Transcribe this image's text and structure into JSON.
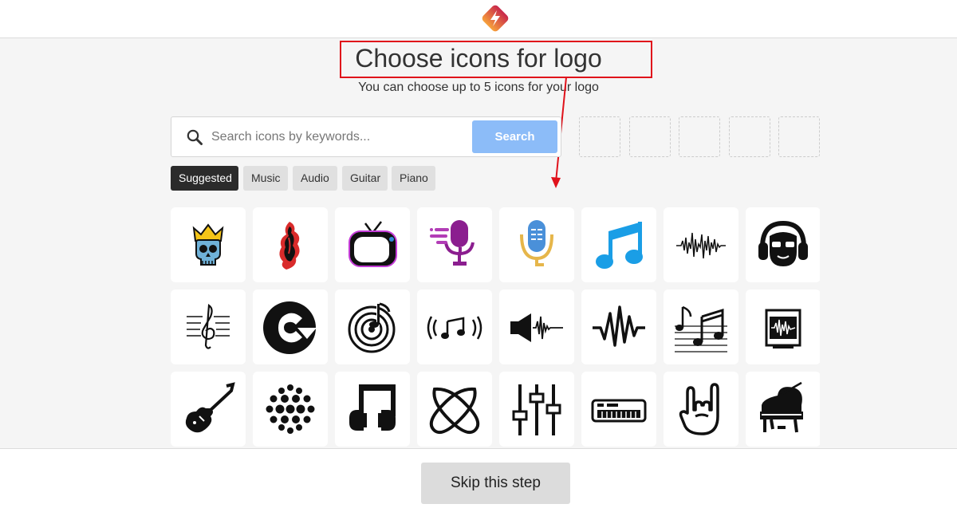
{
  "header": {
    "logo_icon": "brand-logo-icon",
    "colors": {
      "top": "#c8264b",
      "bottom": "#f7a23b",
      "white": "#ffffff"
    }
  },
  "page": {
    "title": "Choose icons for logo",
    "subtitle": "You can choose up to 5 icons for your logo"
  },
  "annotation": {
    "color": "#e0121b"
  },
  "search": {
    "placeholder": "Search icons by keywords...",
    "value": "",
    "button_label": "Search",
    "button_color": "#8cbcf8",
    "selected_slots": 5
  },
  "tags": [
    {
      "label": "Suggested",
      "active": true
    },
    {
      "label": "Music",
      "active": false
    },
    {
      "label": "Audio",
      "active": false
    },
    {
      "label": "Guitar",
      "active": false
    },
    {
      "label": "Piano",
      "active": false
    }
  ],
  "icons": [
    {
      "name": "skull-crown-icon",
      "colors": [
        "#f5c518",
        "#6fb1d8",
        "#111111"
      ]
    },
    {
      "name": "fire-mermaid-icon",
      "colors": [
        "#d92b2b",
        "#111111"
      ]
    },
    {
      "name": "retro-tv-icon",
      "colors": [
        "#111111",
        "#c33bd6",
        "#2f8ad8"
      ]
    },
    {
      "name": "podcast-microphone-icon",
      "colors": [
        "#8b1e8f",
        "#b23db6"
      ]
    },
    {
      "name": "microphone-chat-icon",
      "colors": [
        "#4a90d9",
        "#e6b64a"
      ]
    },
    {
      "name": "music-notes-icon",
      "colors": [
        "#1a9ee6"
      ]
    },
    {
      "name": "sound-wave-icon",
      "colors": [
        "#111111"
      ]
    },
    {
      "name": "headphones-face-icon",
      "colors": [
        "#111111"
      ]
    },
    {
      "name": "treble-clef-icon",
      "colors": [
        "#111111"
      ]
    },
    {
      "name": "circle-c-logo-icon",
      "colors": [
        "#111111"
      ]
    },
    {
      "name": "vinyl-note-icon",
      "colors": [
        "#111111"
      ]
    },
    {
      "name": "music-broadcast-icon",
      "colors": [
        "#111111"
      ]
    },
    {
      "name": "speaker-wave-icon",
      "colors": [
        "#111111"
      ]
    },
    {
      "name": "pulse-wave-icon",
      "colors": [
        "#111111"
      ]
    },
    {
      "name": "sheet-music-icon",
      "colors": [
        "#111111"
      ]
    },
    {
      "name": "audio-monitor-icon",
      "colors": [
        "#111111"
      ]
    },
    {
      "name": "electric-guitar-icon",
      "colors": [
        "#111111"
      ]
    },
    {
      "name": "disco-ball-icon",
      "colors": [
        "#111111"
      ]
    },
    {
      "name": "headphones-note-icon",
      "colors": [
        "#111111"
      ]
    },
    {
      "name": "atom-orbit-icon",
      "colors": [
        "#111111"
      ]
    },
    {
      "name": "mixer-sliders-icon",
      "colors": [
        "#111111"
      ]
    },
    {
      "name": "keyboard-synth-icon",
      "colors": [
        "#111111"
      ]
    },
    {
      "name": "rock-hand-icon",
      "colors": [
        "#111111"
      ]
    },
    {
      "name": "grand-piano-icon",
      "colors": [
        "#111111"
      ]
    }
  ],
  "footer": {
    "skip_label": "Skip this step"
  }
}
